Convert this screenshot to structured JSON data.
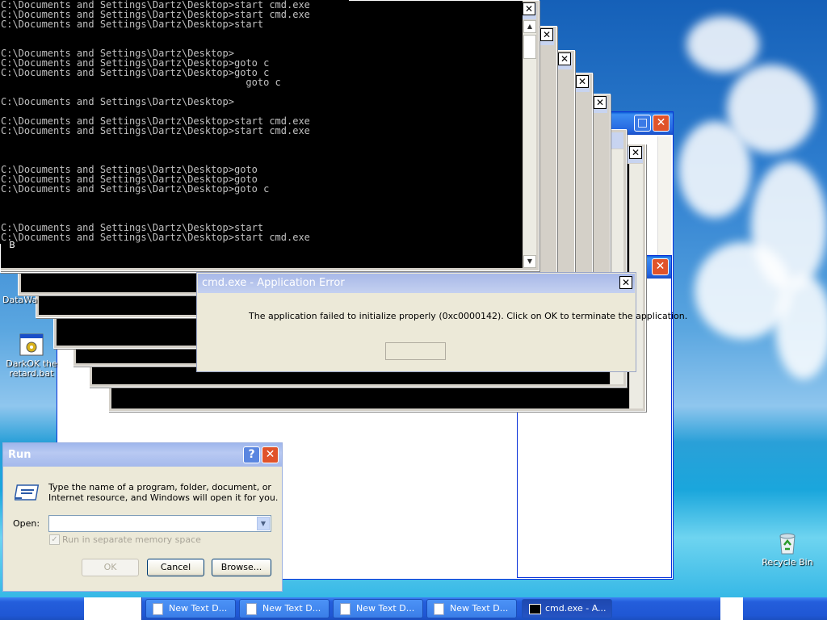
{
  "console": {
    "lines": [
      {
        "row": 0,
        "text": "C:\\Documents and Settings\\Dartz\\Desktop>start cmd.exe"
      },
      {
        "row": 1,
        "text": "C:\\Documents and Settings\\Dartz\\Desktop>start cmd.exe"
      },
      {
        "row": 2,
        "text": "C:\\Documents and Settings\\Dartz\\Desktop>start"
      },
      {
        "row": 5,
        "text": "C:\\Documents and Settings\\Dartz\\Desktop>"
      },
      {
        "row": 6,
        "text": "C:\\Documents and Settings\\Dartz\\Desktop>goto c"
      },
      {
        "row": 7,
        "text": "C:\\Documents and Settings\\Dartz\\Desktop>goto c"
      },
      {
        "row": 8,
        "text": "                                          goto c"
      },
      {
        "row": 10,
        "text": "C:\\Documents and Settings\\Dartz\\Desktop>"
      },
      {
        "row": 12,
        "text": "C:\\Documents and Settings\\Dartz\\Desktop>start cmd.exe"
      },
      {
        "row": 13,
        "text": "C:\\Documents and Settings\\Dartz\\Desktop>start cmd.exe"
      },
      {
        "row": 17,
        "text": "C:\\Documents and Settings\\Dartz\\Desktop>goto"
      },
      {
        "row": 18,
        "text": "C:\\Documents and Settings\\Dartz\\Desktop>goto"
      },
      {
        "row": 19,
        "text": "C:\\Documents and Settings\\Dartz\\Desktop>goto c"
      },
      {
        "row": 23,
        "text": "C:\\Documents and Settings\\Dartz\\Desktop>start"
      },
      {
        "row": 24,
        "text": "C:\\Documents and Settings\\Dartz\\Desktop>start cmd.exe"
      }
    ]
  },
  "desktop": {
    "icons": {
      "datawa": "DataWa",
      "batfile": "DarkOK the retard.bat",
      "recycle": "Recycle Bin",
      "partial_b": "B"
    }
  },
  "error_dialog": {
    "title": "cmd.exe - Application Error",
    "message": "The application failed to initialize properly (0xc0000142). Click on OK to terminate the application.",
    "ok_label": ""
  },
  "run_dialog": {
    "title": "Run",
    "description_line1": "Type the name of a program, folder, document, or",
    "description_line2": "Internet resource, and Windows will open it for you.",
    "open_label": "Open:",
    "open_value": "",
    "checkbox_label": "Run in separate memory space",
    "ok_label": "OK",
    "cancel_label": "Cancel",
    "browse_label": "Browse..."
  },
  "caption_glyphs": {
    "minimize": "_",
    "maximize": "□",
    "close": "✕",
    "help": "?"
  },
  "taskbar": {
    "tasks": [
      "New Text D...",
      "New Text D...",
      "New Text D...",
      "New Text D...",
      "cmd.exe - A..."
    ]
  },
  "colors": {
    "xp_title_blue": "#2566e0",
    "inactive_title": "#a8b8e8",
    "console_bg": "#000000",
    "console_fg": "#c0c0c0"
  }
}
